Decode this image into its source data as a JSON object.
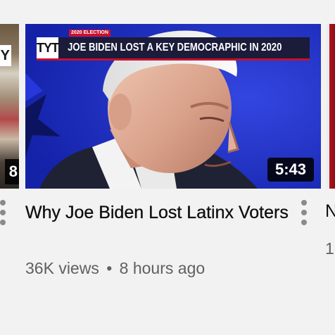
{
  "video": {
    "category_tag": "2020 ELECTION",
    "channel_logo": "TYT",
    "banner_headline": "JOE BIDEN LOST A KEY DEMOCRAPHIC IN 2020",
    "duration": "5:43",
    "title": "Why Joe Biden Lost Latinx Voters",
    "views": "36K views",
    "separator": "•",
    "age": "8 hours ago",
    "menu_icon": "more-vert-icon"
  },
  "left_card": {
    "thumb_fragment": "Y",
    "duration_fragment": "8",
    "menu_icon": "more-vert-icon"
  },
  "right_card": {
    "title_fragment": "N",
    "meta_fragment": "1"
  },
  "colors": {
    "background": "#f2f2f2",
    "title": "#0f0f0f",
    "meta": "#606060",
    "thumb_blue": "#1c2bbf",
    "banner_red": "#c8102e"
  }
}
